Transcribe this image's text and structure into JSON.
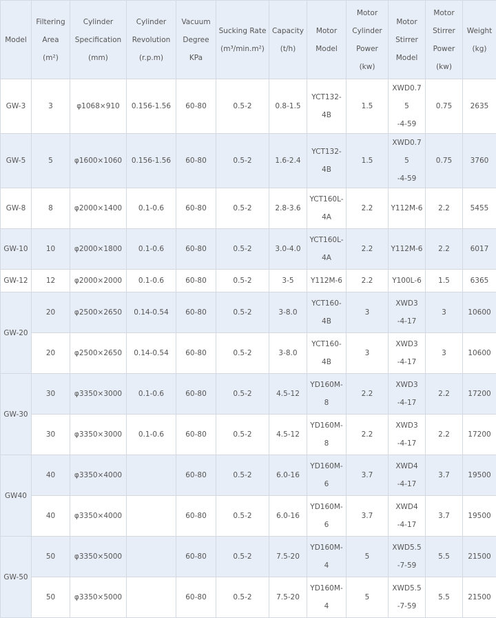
{
  "headers": {
    "model": "Model",
    "filtering_area": [
      "Filtering",
      "Area",
      "(m²)"
    ],
    "cylinder_spec": [
      "Cylinder",
      "Specification",
      "(mm)"
    ],
    "cylinder_rev": [
      "Cylinder",
      "Revolution",
      "(r.p.m)"
    ],
    "vacuum": [
      "Vacuum",
      "Degree",
      "KPa"
    ],
    "sucking_rate": [
      "Sucking Rate",
      "(m³/min.m²)"
    ],
    "capacity": [
      "Capacity",
      "(t/h)"
    ],
    "motor_model": [
      "Motor",
      "Model"
    ],
    "motor_cyl_power": [
      "Motor",
      "Cylinder",
      "Power",
      "(kw)"
    ],
    "motor_stirrer_model": [
      "Motor",
      "Stirrer",
      "Model"
    ],
    "motor_stirrer_power": [
      "Motor",
      "Stirrer",
      "Power",
      "(kw)"
    ],
    "weight": [
      "Weight",
      "(kg)"
    ]
  },
  "rows": [
    {
      "model": "GW-3",
      "area": "3",
      "spec": "φ1068×910",
      "rev": "0.156-1.56",
      "vacuum": "60-80",
      "suck": "0.5-2",
      "cap": "0.8-1.5",
      "motor": [
        "YCT132-",
        "4B"
      ],
      "mpow": "1.5",
      "stir": [
        "XWD0.75",
        "-4-59"
      ],
      "spow": "0.75",
      "weight": "2635"
    },
    {
      "model": "GW-5",
      "area": "5",
      "spec": "φ1600×1060",
      "rev": "0.156-1.56",
      "vacuum": "60-80",
      "suck": "0.5-2",
      "cap": "1.6-2.4",
      "motor": [
        "YCT132-",
        "4B"
      ],
      "mpow": "1.5",
      "stir": [
        "XWD0.75",
        "-4-59"
      ],
      "spow": "0.75",
      "weight": "3760"
    },
    {
      "model": "GW-8",
      "area": "8",
      "spec": "φ2000×1400",
      "rev": "0.1-0.6",
      "vacuum": "60-80",
      "suck": "0.5-2",
      "cap": "2.8-3.6",
      "motor": [
        "YCT160L-",
        "4A"
      ],
      "mpow": "2.2",
      "stir": [
        "Y112M-6"
      ],
      "spow": "2.2",
      "weight": "5455"
    },
    {
      "model": "GW-10",
      "area": "10",
      "spec": "φ2000×1800",
      "rev": "0.1-0.6",
      "vacuum": "60-80",
      "suck": "0.5-2",
      "cap": "3.0-4.0",
      "motor": [
        "YCT160L-",
        "4A"
      ],
      "mpow": "2.2",
      "stir": [
        "Y112M-6"
      ],
      "spow": "2.2",
      "weight": "6017"
    },
    {
      "model": "GW-12",
      "area": "12",
      "spec": "φ2000×2000",
      "rev": "0.1-0.6",
      "vacuum": "60-80",
      "suck": "0.5-2",
      "cap": "3-5",
      "motor": [
        "Y112M-6"
      ],
      "mpow": "2.2",
      "stir": [
        "Y100L-6"
      ],
      "spow": "1.5",
      "weight": "6365"
    },
    {
      "model": "GW-20",
      "area": "20",
      "spec": "φ2500×2650",
      "rev": "0.14-0.54",
      "vacuum": "60-80",
      "suck": "0.5-2",
      "cap": "3-8.0",
      "motor": [
        "YCT160-",
        "4B"
      ],
      "mpow": "3",
      "stir": [
        "XWD3",
        "-4-17"
      ],
      "spow": "3",
      "weight": "10600"
    },
    {
      "model": "",
      "area": "20",
      "spec": "φ2500×2650",
      "rev": "0.14-0.54",
      "vacuum": "60-80",
      "suck": "0.5-2",
      "cap": "3-8.0",
      "motor": [
        "YCT160-",
        "4B"
      ],
      "mpow": "3",
      "stir": [
        "XWD3",
        "-4-17"
      ],
      "spow": "3",
      "weight": "10600"
    },
    {
      "model": "GW-30",
      "area": "30",
      "spec": "φ3350×3000",
      "rev": "0.1-0.6",
      "vacuum": "60-80",
      "suck": "0.5-2",
      "cap": "4.5-12",
      "motor": [
        "YD160M-",
        "8"
      ],
      "mpow": "2.2",
      "stir": [
        "XWD3",
        "-4-17"
      ],
      "spow": "2.2",
      "weight": "17200"
    },
    {
      "model": "",
      "area": "30",
      "spec": "φ3350×3000",
      "rev": "0.1-0.6",
      "vacuum": "60-80",
      "suck": "0.5-2",
      "cap": "4.5-12",
      "motor": [
        "YD160M-",
        "8"
      ],
      "mpow": "2.2",
      "stir": [
        "XWD3",
        "-4-17"
      ],
      "spow": "2.2",
      "weight": "17200"
    },
    {
      "model": "GW40",
      "area": "40",
      "spec": "φ3350×4000",
      "rev": "",
      "vacuum": "60-80",
      "suck": "0.5-2",
      "cap": "6.0-16",
      "motor": [
        "YD160M-",
        "6"
      ],
      "mpow": "3.7",
      "stir": [
        "XWD4",
        "-4-17"
      ],
      "spow": "3.7",
      "weight": "19500"
    },
    {
      "model": "",
      "area": "40",
      "spec": "φ3350×4000",
      "rev": "",
      "vacuum": "60-80",
      "suck": "0.5-2",
      "cap": "6.0-16",
      "motor": [
        "YD160M-",
        "6"
      ],
      "mpow": "3.7",
      "stir": [
        "XWD4",
        "-4-17"
      ],
      "spow": "3.7",
      "weight": "19500"
    },
    {
      "model": "GW-50",
      "area": "50",
      "spec": "φ3350×5000",
      "rev": "",
      "vacuum": "60-80",
      "suck": "0.5-2",
      "cap": "7.5-20",
      "motor": [
        "YD160M-",
        "4"
      ],
      "mpow": "5",
      "stir": [
        "XWD5.5",
        "-7-59"
      ],
      "spow": "5.5",
      "weight": "21500"
    },
    {
      "model": "",
      "area": "50",
      "spec": "φ3350×5000",
      "rev": "",
      "vacuum": "60-80",
      "suck": "0.5-2",
      "cap": "7.5-20",
      "motor": [
        "YD160M-",
        "4"
      ],
      "mpow": "5",
      "stir": [
        "XWD5.5",
        "-7-59"
      ],
      "spow": "5.5",
      "weight": "21500"
    }
  ]
}
